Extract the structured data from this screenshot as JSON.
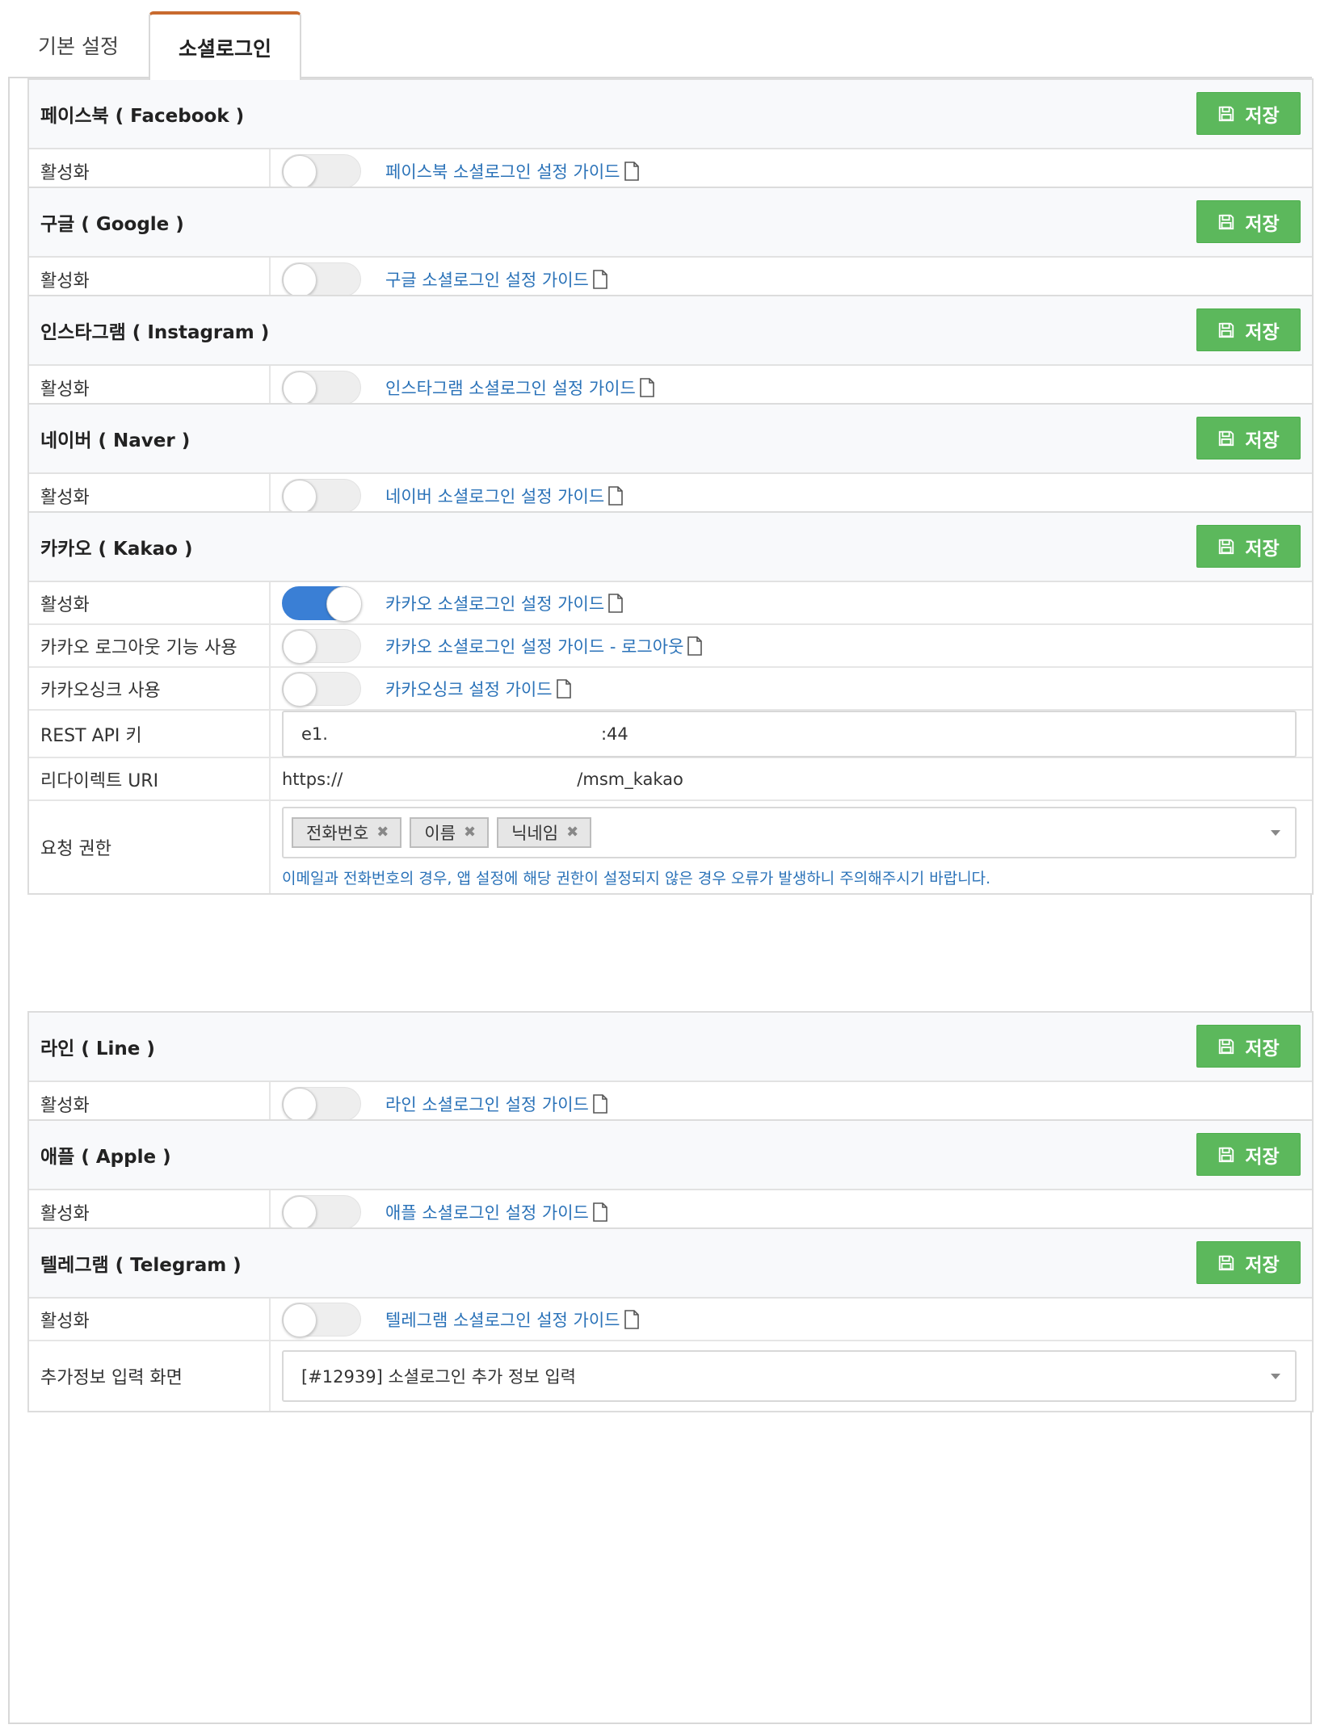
{
  "tabs": {
    "basic": "기본 설정",
    "social": "소셜로그인"
  },
  "common": {
    "save": "저장",
    "activate": "활성화"
  },
  "facebook": {
    "title": "페이스북 ( Facebook )",
    "guide": "페이스북 소셜로그인 설정 가이드",
    "enabled": false
  },
  "google": {
    "title": "구글 ( Google )",
    "guide": "구글 소셜로그인 설정 가이드",
    "enabled": false
  },
  "instagram": {
    "title": "인스타그램 ( Instagram )",
    "guide": "인스타그램 소셜로그인 설정 가이드",
    "enabled": false
  },
  "naver": {
    "title": "네이버 ( Naver )",
    "guide": "네이버 소셜로그인 설정 가이드",
    "enabled": false
  },
  "kakao": {
    "title": "카카오 ( Kakao )",
    "guide": "카카오 소셜로그인 설정 가이드",
    "enabled": true,
    "logout_label": "카카오 로그아웃 기능 사용",
    "logout_guide": "카카오 소셜로그인 설정 가이드 - 로그아웃",
    "logout_enabled": false,
    "sync_label": "카카오싱크 사용",
    "sync_guide": "카카오싱크 설정 가이드",
    "sync_enabled": false,
    "rest_api_label": "REST API 키",
    "rest_api_prefix": "e1.",
    "rest_api_suffix": ":44",
    "redirect_label": "리다이렉트 URI",
    "redirect_prefix": "https://",
    "redirect_suffix": "/msm_kakao",
    "scope_label": "요청 권한",
    "scopes": [
      "전화번호",
      "이름",
      "닉네임"
    ],
    "scope_hint": "이메일과 전화번호의 경우, 앱 설정에 해당 권한이 설정되지 않은 경우 오류가 발생하니 주의해주시기 바랍니다."
  },
  "line": {
    "title": "라인 ( Line )",
    "guide": "라인 소셜로그인 설정 가이드",
    "enabled": false
  },
  "apple": {
    "title": "애플 ( Apple )",
    "guide": "애플 소셜로그인 설정 가이드",
    "enabled": false
  },
  "telegram": {
    "title": "텔레그램 ( Telegram )",
    "guide": "텔레그램 소셜로그인 설정 가이드",
    "enabled": false,
    "extra_label": "추가정보 입력 화면",
    "extra_value": "[#12939] 소셜로그인 추가 정보 입력"
  },
  "colors": {
    "save_green": "#5cb85c",
    "toggle_on": "#3a7fd5",
    "link_blue": "#2a72b8",
    "tab_accent": "#c86a2e"
  },
  "icons": {
    "save": "floppy-disk-icon",
    "guide": "document-icon",
    "remove": "close-icon",
    "select": "caret-down-icon"
  }
}
